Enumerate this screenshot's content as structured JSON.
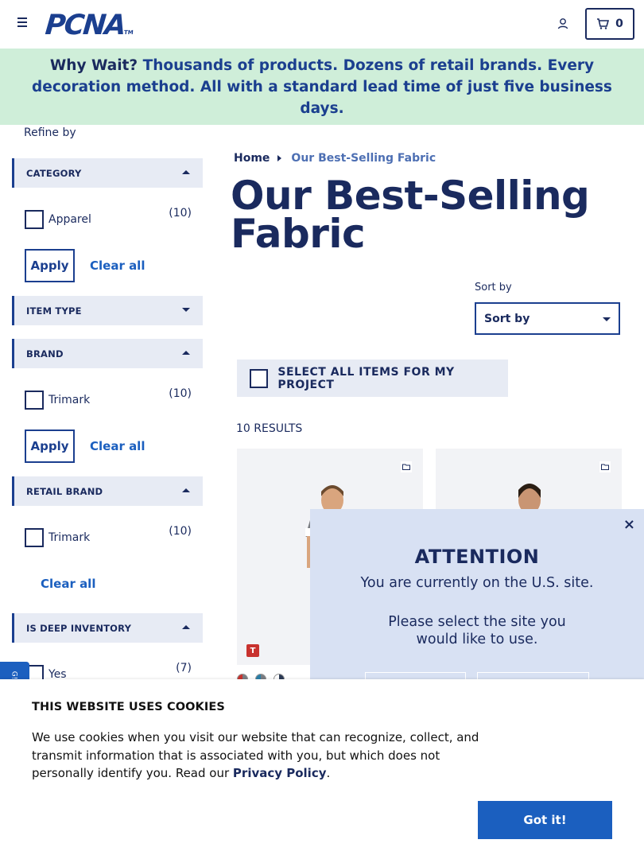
{
  "header": {
    "logo_text": "PCNA",
    "logo_tm": "TM",
    "cart_count": "0"
  },
  "banner": {
    "lead": "Why Wait?",
    "text": "Thousands of products. Dozens of retail brands. Every decoration method. All with a standard lead time of just five business days."
  },
  "sidebar": {
    "refine_label": "Refine by",
    "facets": [
      {
        "title": "CATEGORY",
        "expanded": true,
        "options": [
          {
            "label": "Apparel",
            "count": "(10)"
          }
        ],
        "apply": "Apply",
        "clear": "Clear all"
      },
      {
        "title": "ITEM TYPE",
        "expanded": false
      },
      {
        "title": "BRAND",
        "expanded": true,
        "options": [
          {
            "label": "Trimark",
            "count": "(10)"
          }
        ],
        "apply": "Apply",
        "clear": "Clear all"
      },
      {
        "title": "RETAIL BRAND",
        "expanded": true,
        "options": [
          {
            "label": "Trimark",
            "count": "(10)"
          }
        ],
        "clear": "Clear all"
      },
      {
        "title": "IS DEEP INVENTORY",
        "expanded": true,
        "options": [
          {
            "label": "Yes",
            "count": "(7)"
          }
        ]
      }
    ]
  },
  "breadcrumb": {
    "home": "Home",
    "current": "Our Best-Selling Fabric"
  },
  "main": {
    "title": "Our Best-Selling Fabric",
    "sort_label": "Sort by",
    "sort_value": "Sort by",
    "select_all": "SELECT ALL ITEMS FOR MY PROJECT",
    "results": "10 RESULTS",
    "brand_badge": "T",
    "swatch_colors": [
      "#c8322e",
      "#2a7fa8",
      "#ffffff"
    ]
  },
  "modal": {
    "title": "ATTENTION",
    "line1": "You are currently on the U.S. site.",
    "line2": "Please select the site you",
    "line3": "would like to use.",
    "close": "×"
  },
  "side_tab": {
    "label": "G!"
  },
  "cookie": {
    "title": "THIS WEBSITE USES COOKIES",
    "text": "We use cookies when you visit our website that can recognize, collect, and transmit information that is associated with you, but which does not personally identify you. Read our",
    "link": "Privacy Policy",
    "period": ".",
    "button": "Got it!"
  },
  "colors": {
    "navy": "#1a2a5e",
    "brand_blue": "#1b3f8f",
    "banner_bg": "#cfeed9",
    "accent_blue": "#1b5fbf"
  }
}
